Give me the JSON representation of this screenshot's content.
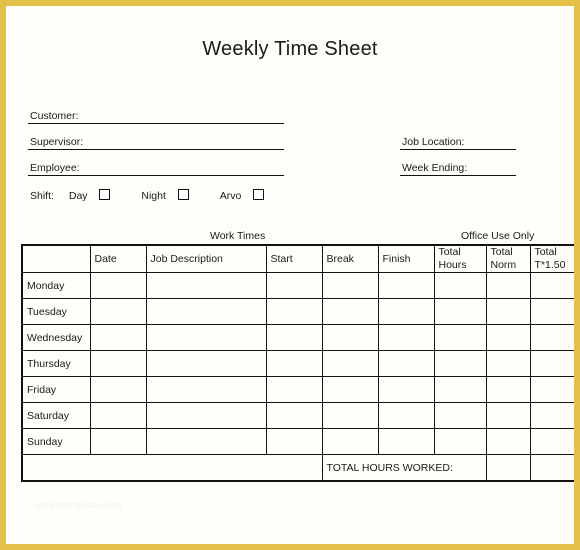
{
  "document": {
    "title": "Weekly Time Sheet",
    "watermark": "sampletemplates.com"
  },
  "form": {
    "left_fields": [
      {
        "label": "Customer:",
        "value": ""
      },
      {
        "label": "Supervisor:",
        "value": ""
      },
      {
        "label": "Employee:",
        "value": ""
      }
    ],
    "right_fields": [
      {
        "label": "Job Location:",
        "value": ""
      },
      {
        "label": "Week Ending:",
        "value": ""
      }
    ],
    "shift": {
      "label": "Shift:",
      "options": [
        {
          "name": "Day",
          "checked": false
        },
        {
          "name": "Night",
          "checked": false
        },
        {
          "name": "Arvo",
          "checked": false
        }
      ]
    }
  },
  "table": {
    "captions": {
      "work_times": "Work Times",
      "office_use": "Office Use Only"
    },
    "headers": [
      "",
      "Date",
      "Job Description",
      "Start",
      "Break",
      "Finish",
      "Total Hours",
      "Total Norm",
      "Total T*1.50"
    ],
    "headers_wrapped": [
      {
        "line1": "",
        "line2": ""
      },
      {
        "line1": "Date",
        "line2": ""
      },
      {
        "line1": "Job Description",
        "line2": ""
      },
      {
        "line1": "Start",
        "line2": ""
      },
      {
        "line1": "Break",
        "line2": ""
      },
      {
        "line1": "Finish",
        "line2": ""
      },
      {
        "line1": "Total",
        "line2": "Hours"
      },
      {
        "line1": "Total",
        "line2": "Norm"
      },
      {
        "line1": "Total",
        "line2": "T*1.50"
      }
    ],
    "rows": [
      {
        "day": "Monday",
        "date": "",
        "job_description": "",
        "start": "",
        "break": "",
        "finish": "",
        "total_hours": "",
        "total_norm": "",
        "total_t150": ""
      },
      {
        "day": "Tuesday",
        "date": "",
        "job_description": "",
        "start": "",
        "break": "",
        "finish": "",
        "total_hours": "",
        "total_norm": "",
        "total_t150": ""
      },
      {
        "day": "Wednesday",
        "date": "",
        "job_description": "",
        "start": "",
        "break": "",
        "finish": "",
        "total_hours": "",
        "total_norm": "",
        "total_t150": ""
      },
      {
        "day": "Thursday",
        "date": "",
        "job_description": "",
        "start": "",
        "break": "",
        "finish": "",
        "total_hours": "",
        "total_norm": "",
        "total_t150": ""
      },
      {
        "day": "Friday",
        "date": "",
        "job_description": "",
        "start": "",
        "break": "",
        "finish": "",
        "total_hours": "",
        "total_norm": "",
        "total_t150": ""
      },
      {
        "day": "Saturday",
        "date": "",
        "job_description": "",
        "start": "",
        "break": "",
        "finish": "",
        "total_hours": "",
        "total_norm": "",
        "total_t150": ""
      },
      {
        "day": "Sunday",
        "date": "",
        "job_description": "",
        "start": "",
        "break": "",
        "finish": "",
        "total_hours": "",
        "total_norm": "",
        "total_t150": ""
      }
    ],
    "total_row": {
      "label": "TOTAL HOURS WORKED:",
      "value_norm": "",
      "value_t150": ""
    }
  },
  "colors": {
    "border_frame": "#e3c04a",
    "page": "#fffefb",
    "ink": "#1a1a1a"
  }
}
